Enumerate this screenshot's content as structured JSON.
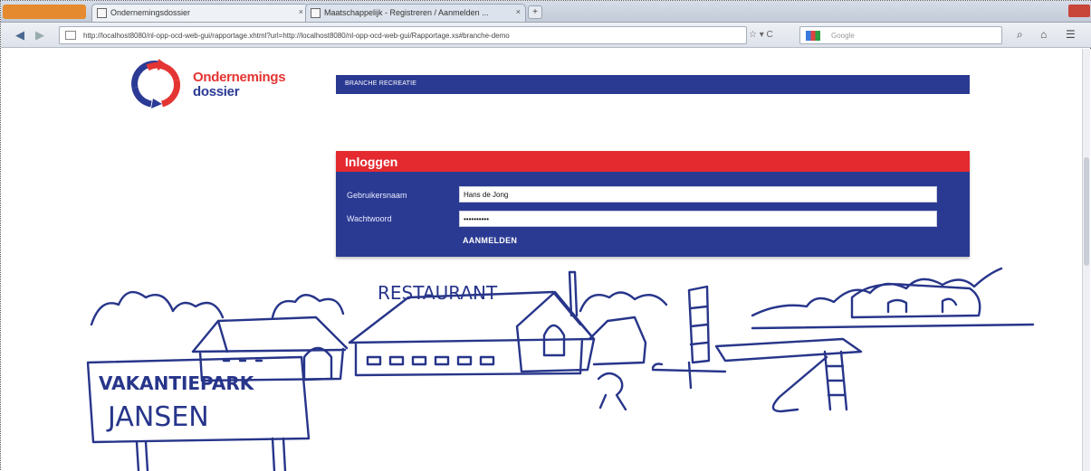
{
  "browser": {
    "tabs": [
      {
        "title": "Ondernemingsdossier"
      },
      {
        "title": "Maatschappelijk - Registreren / Aanmelden ..."
      }
    ],
    "new_tab": "+",
    "address": "http://localhost8080/nl-opp-ocd-web-gui/rapportage.xhtml?url=http://localhost8080/nl-opp-ocd-web-gui/Rapportage.xs#branche-demo",
    "address_tools": "☆ ▾ C",
    "search_placeholder": "Google",
    "icons": [
      "back-icon",
      "forward-icon",
      "search-icon",
      "home-icon",
      "bookmarks-icon"
    ]
  },
  "site": {
    "logo_line1": "Ondernemings",
    "logo_line2": "dossier",
    "branch_label": "BRANCHE RECREATIE"
  },
  "login": {
    "title": "Inloggen",
    "username_label": "Gebruikersnaam",
    "username_value": "Hans de Jong",
    "password_label": "Wachtwoord",
    "password_value": "••••••••••",
    "submit_label": "AANMELDEN"
  },
  "illustration": {
    "sign_line1": "VAKANTIEPARK",
    "sign_line2": "JANSEN",
    "restaurant_label": "RESTAURANT"
  },
  "colors": {
    "brand_blue": "#2a3a92",
    "brand_red": "#e42a2f",
    "sketch_ink": "#27358a"
  }
}
